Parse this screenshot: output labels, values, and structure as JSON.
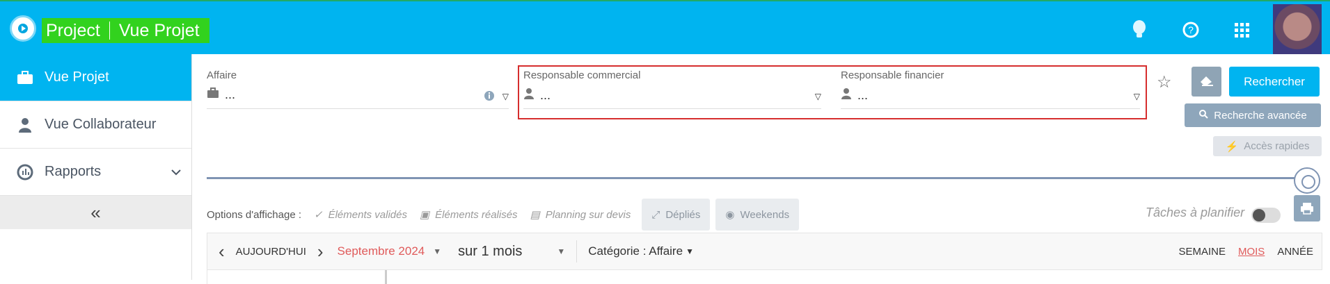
{
  "header": {
    "title_primary": "Project",
    "title_secondary": "Vue Projet"
  },
  "sidebar": {
    "items": [
      {
        "label": "Vue Projet",
        "icon": "briefcase-icon",
        "active": true
      },
      {
        "label": "Vue Collaborateur",
        "icon": "user-icon",
        "active": false
      },
      {
        "label": "Rapports",
        "icon": "report-icon",
        "active": false
      }
    ],
    "collapse_label": "«"
  },
  "filters": {
    "affaire": {
      "label": "Affaire",
      "value": "..."
    },
    "responsable_commercial": {
      "label": "Responsable commercial",
      "value": "..."
    },
    "responsable_financier": {
      "label": "Responsable financier",
      "value": "..."
    }
  },
  "actions": {
    "search": "Rechercher",
    "advanced_search": "Recherche avancée",
    "quick_access": "Accès rapides"
  },
  "display_options": {
    "label": "Options d'affichage :",
    "items": [
      "Éléments validés",
      "Éléments réalisés",
      "Planning sur devis"
    ],
    "buttons": [
      "Dépliés",
      "Weekends"
    ],
    "tasks_label": "Tâches à planifier"
  },
  "calendar": {
    "today": "AUJOURD'HUI",
    "month": "Septembre 2024",
    "period": "sur 1 mois",
    "category": "Catégorie : Affaire",
    "views": [
      "SEMAINE",
      "MOIS",
      "ANNÉE"
    ],
    "active_view": "MOIS"
  },
  "colors": {
    "accent": "#00b4f0",
    "title_highlight": "#32d21e",
    "red_highlight": "#d62d2d"
  }
}
